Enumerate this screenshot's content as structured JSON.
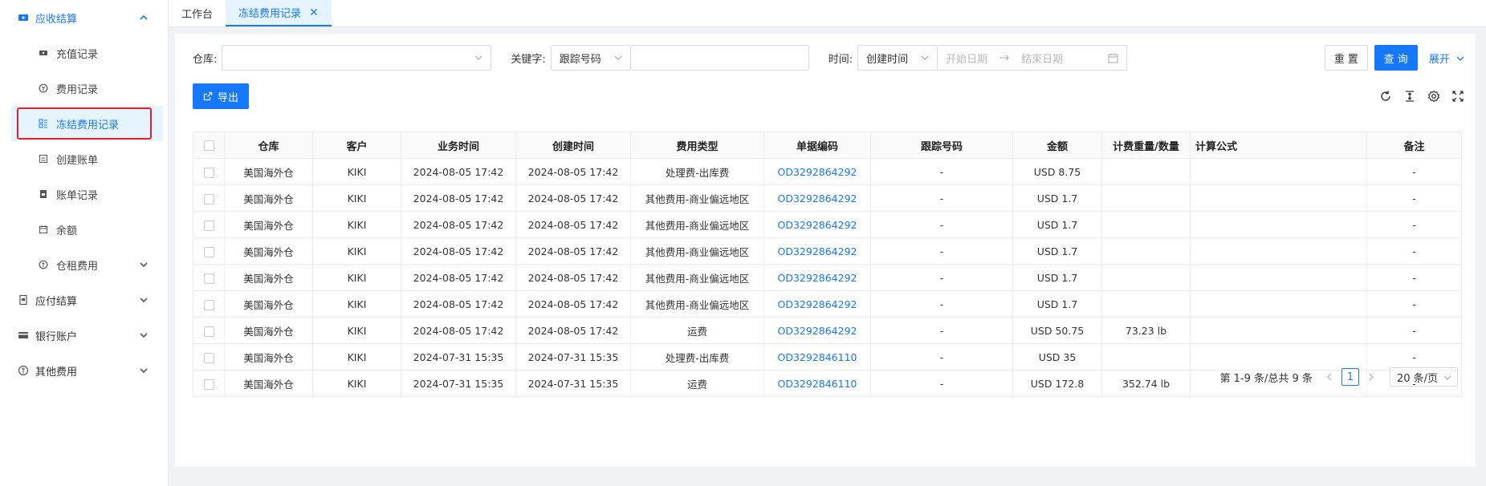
{
  "sidebar": {
    "groups": [
      {
        "label": "应收结算",
        "icon": "ticket-icon",
        "open": true
      },
      {
        "label": "应付结算",
        "icon": "wallet-icon"
      },
      {
        "label": "银行账户",
        "icon": "bank-card-icon"
      },
      {
        "label": "其他费用",
        "icon": "coin-icon"
      }
    ],
    "sub_items": [
      {
        "label": "充值记录",
        "icon": "ticket-icon"
      },
      {
        "label": "费用记录",
        "icon": "money-circle-icon"
      },
      {
        "label": "冻结费用记录",
        "icon": "frozen-list-icon",
        "active": true
      },
      {
        "label": "创建账单",
        "icon": "bill-create-icon"
      },
      {
        "label": "账单记录",
        "icon": "bill-record-icon"
      },
      {
        "label": "余额",
        "icon": "balance-icon"
      },
      {
        "label": "仓租费用",
        "icon": "coin-icon",
        "expandable": true
      }
    ]
  },
  "tabs": [
    {
      "label": "工作台"
    },
    {
      "label": "冻结费用记录",
      "active": true
    }
  ],
  "filters": {
    "warehouse_label": "仓库:",
    "warehouse_value": "",
    "keyword_label": "关键字:",
    "keyword_type": "跟踪号码",
    "keyword_value": "",
    "time_label": "时间:",
    "time_type": "创建时间",
    "start_placeholder": "开始日期",
    "end_placeholder": "结束日期",
    "reset_label": "重 置",
    "search_label": "查 询",
    "expand_label": "展开"
  },
  "toolbar": {
    "export_label": "导出"
  },
  "table": {
    "columns": [
      "仓库",
      "客户",
      "业务时间",
      "创建时间",
      "费用类型",
      "单据编码",
      "跟踪号码",
      "金额",
      "计费重量/数量",
      "计算公式",
      "备注"
    ],
    "rows": [
      [
        "美国海外仓",
        "KIKI",
        "2024-08-05 17:42",
        "2024-08-05 17:42",
        "处理费-出库费",
        "OD3292864292",
        "-",
        "USD 8.75",
        "",
        "",
        "-"
      ],
      [
        "美国海外仓",
        "KIKI",
        "2024-08-05 17:42",
        "2024-08-05 17:42",
        "其他费用-商业偏远地区",
        "OD3292864292",
        "-",
        "USD 1.7",
        "",
        "",
        "-"
      ],
      [
        "美国海外仓",
        "KIKI",
        "2024-08-05 17:42",
        "2024-08-05 17:42",
        "其他费用-商业偏远地区",
        "OD3292864292",
        "-",
        "USD 1.7",
        "",
        "",
        "-"
      ],
      [
        "美国海外仓",
        "KIKI",
        "2024-08-05 17:42",
        "2024-08-05 17:42",
        "其他费用-商业偏远地区",
        "OD3292864292",
        "-",
        "USD 1.7",
        "",
        "",
        "-"
      ],
      [
        "美国海外仓",
        "KIKI",
        "2024-08-05 17:42",
        "2024-08-05 17:42",
        "其他费用-商业偏远地区",
        "OD3292864292",
        "-",
        "USD 1.7",
        "",
        "",
        "-"
      ],
      [
        "美国海外仓",
        "KIKI",
        "2024-08-05 17:42",
        "2024-08-05 17:42",
        "其他费用-商业偏远地区",
        "OD3292864292",
        "-",
        "USD 1.7",
        "",
        "",
        "-"
      ],
      [
        "美国海外仓",
        "KIKI",
        "2024-08-05 17:42",
        "2024-08-05 17:42",
        "运费",
        "OD3292864292",
        "-",
        "USD 50.75",
        "73.23 lb",
        "",
        "-"
      ],
      [
        "美国海外仓",
        "KIKI",
        "2024-07-31 15:35",
        "2024-07-31 15:35",
        "处理费-出库费",
        "OD3292846110",
        "-",
        "USD 35",
        "",
        "",
        "-"
      ],
      [
        "美国海外仓",
        "KIKI",
        "2024-07-31 15:35",
        "2024-07-31 15:35",
        "运费",
        "OD3292846110",
        "-",
        "USD 172.8",
        "352.74 lb",
        "",
        "-"
      ]
    ]
  },
  "pager": {
    "summary": "第 1-9 条/总共 9 条",
    "current_page": "1",
    "page_size": "20 条/页"
  },
  "colors": {
    "primary": "#1677ff",
    "highlight": "#e8202a"
  }
}
